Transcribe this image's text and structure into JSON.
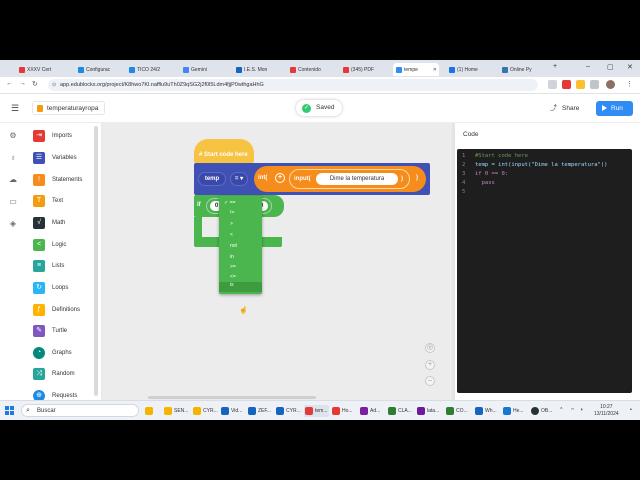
{
  "colors": {
    "brand_blue": "#2f8cf5",
    "workspace_bg": "#ececec",
    "hat_yellow": "#f6c343",
    "variables_blue": "#3f51b5",
    "operators_orange": "#f58c1c",
    "logic_green": "#4bb54e",
    "editor_bg": "#1e1e1e"
  },
  "browser": {
    "tabs": [
      {
        "label": "XXXV Cert",
        "icon": "page-icon",
        "color": "#e53935"
      },
      {
        "label": "Configurac",
        "icon": "page-icon",
        "color": "#1e88e5"
      },
      {
        "label": "TICO 24/2",
        "icon": "page-icon",
        "color": "#1e88e5"
      },
      {
        "label": "Gemini",
        "icon": "gemini-icon",
        "color": "#4285f4"
      },
      {
        "label": "I.E.S. Mon",
        "icon": "page-icon",
        "color": "#1565c0"
      },
      {
        "label": "Contenido",
        "icon": "page-icon",
        "color": "#e53935"
      },
      {
        "label": "(345) PDF",
        "icon": "youtube-icon",
        "color": "#e53935"
      },
      {
        "label": "tempe",
        "icon": "edublocks-icon",
        "color": "#2f8cf5"
      },
      {
        "label": "(1) Home",
        "icon": "page-icon",
        "color": "#1a73e8"
      },
      {
        "label": "Online Py",
        "icon": "page-icon",
        "color": "#3776ab"
      }
    ],
    "url": "app.edublocks.org/project/K8hwo7Kl.nafflu9uTh0Z9qSG2j2f0l5Ldm4fjjP0wthgaHhG"
  },
  "header": {
    "project_name": "temperaturayropa",
    "saved_label": "Saved",
    "share_label": "Share",
    "run_label": "Run"
  },
  "toolbox": {
    "categories": [
      {
        "label": "Imports",
        "color": "#e53935",
        "icon": "import-icon"
      },
      {
        "label": "Variables",
        "color": "#3f51b5",
        "icon": "variables-icon"
      },
      {
        "label": "Statements",
        "color": "#f58c1c",
        "icon": "statements-icon"
      },
      {
        "label": "Text",
        "color": "#f39c12",
        "icon": "text-icon"
      },
      {
        "label": "Math",
        "color": "#263238",
        "icon": "math-icon"
      },
      {
        "label": "Logic",
        "color": "#4bb54e",
        "icon": "logic-icon"
      },
      {
        "label": "Lists",
        "color": "#26a69a",
        "icon": "lists-icon"
      },
      {
        "label": "Loops",
        "color": "#29b6f6",
        "icon": "loops-icon"
      },
      {
        "label": "Definitions",
        "color": "#ffb300",
        "icon": "definitions-icon"
      },
      {
        "label": "Turtle",
        "color": "#7e57c2",
        "icon": "turtle-icon"
      },
      {
        "label": "Graphs",
        "color": "#00897b",
        "icon": "graphs-icon"
      },
      {
        "label": "Random",
        "color": "#26a69a",
        "icon": "random-icon"
      },
      {
        "label": "Requests",
        "color": "#1e88e5",
        "icon": "requests-icon"
      }
    ]
  },
  "blocks": {
    "hat": "# Start code here",
    "var_name": "temp",
    "assign_op": "=",
    "int_label": "int(",
    "input_label": "input(",
    "prompt_text": "Dime la temperatura",
    "if_label": "if",
    "left_value": "0",
    "compare_op": "==",
    "right_value": "0",
    "operator_options": [
      "==",
      "!=",
      ">",
      "<",
      "not",
      "in",
      ">=",
      "<=",
      "is"
    ]
  },
  "code": {
    "tab_label": "Code",
    "lines": [
      {
        "no": "1",
        "text": "#Start code here"
      },
      {
        "no": "2",
        "text": "temp = int(input(\"Dime la temperatura\"))"
      },
      {
        "no": "3",
        "text": "if 0 == 0:"
      },
      {
        "no": "4",
        "text": "  pass"
      },
      {
        "no": "5",
        "text": ""
      }
    ]
  },
  "taskbar": {
    "search_placeholder": "Buscar",
    "apps": [
      {
        "label": "SEN...",
        "color": "#f4b400"
      },
      {
        "label": "CYR...",
        "color": "#f4b400"
      },
      {
        "label": "Vid...",
        "color": "#1565c0"
      },
      {
        "label": "ZEF...",
        "color": "#1565c0"
      },
      {
        "label": "CYR...",
        "color": "#1565c0"
      },
      {
        "label": "tem...",
        "color": "#e53935"
      },
      {
        "label": "Ho...",
        "color": "#e53935"
      },
      {
        "label": "Ad...",
        "color": "#7b1fa2"
      },
      {
        "label": "CLA...",
        "color": "#2e7d32"
      },
      {
        "label": "lata...",
        "color": "#6a1b9a"
      },
      {
        "label": "CO...",
        "color": "#2e7d32"
      },
      {
        "label": "Wh...",
        "color": "#1565c0"
      },
      {
        "label": "He...",
        "color": "#1976d2"
      },
      {
        "label": "OB...",
        "color": "#263238"
      }
    ],
    "time": "10:27",
    "date": "13/11/2024"
  }
}
